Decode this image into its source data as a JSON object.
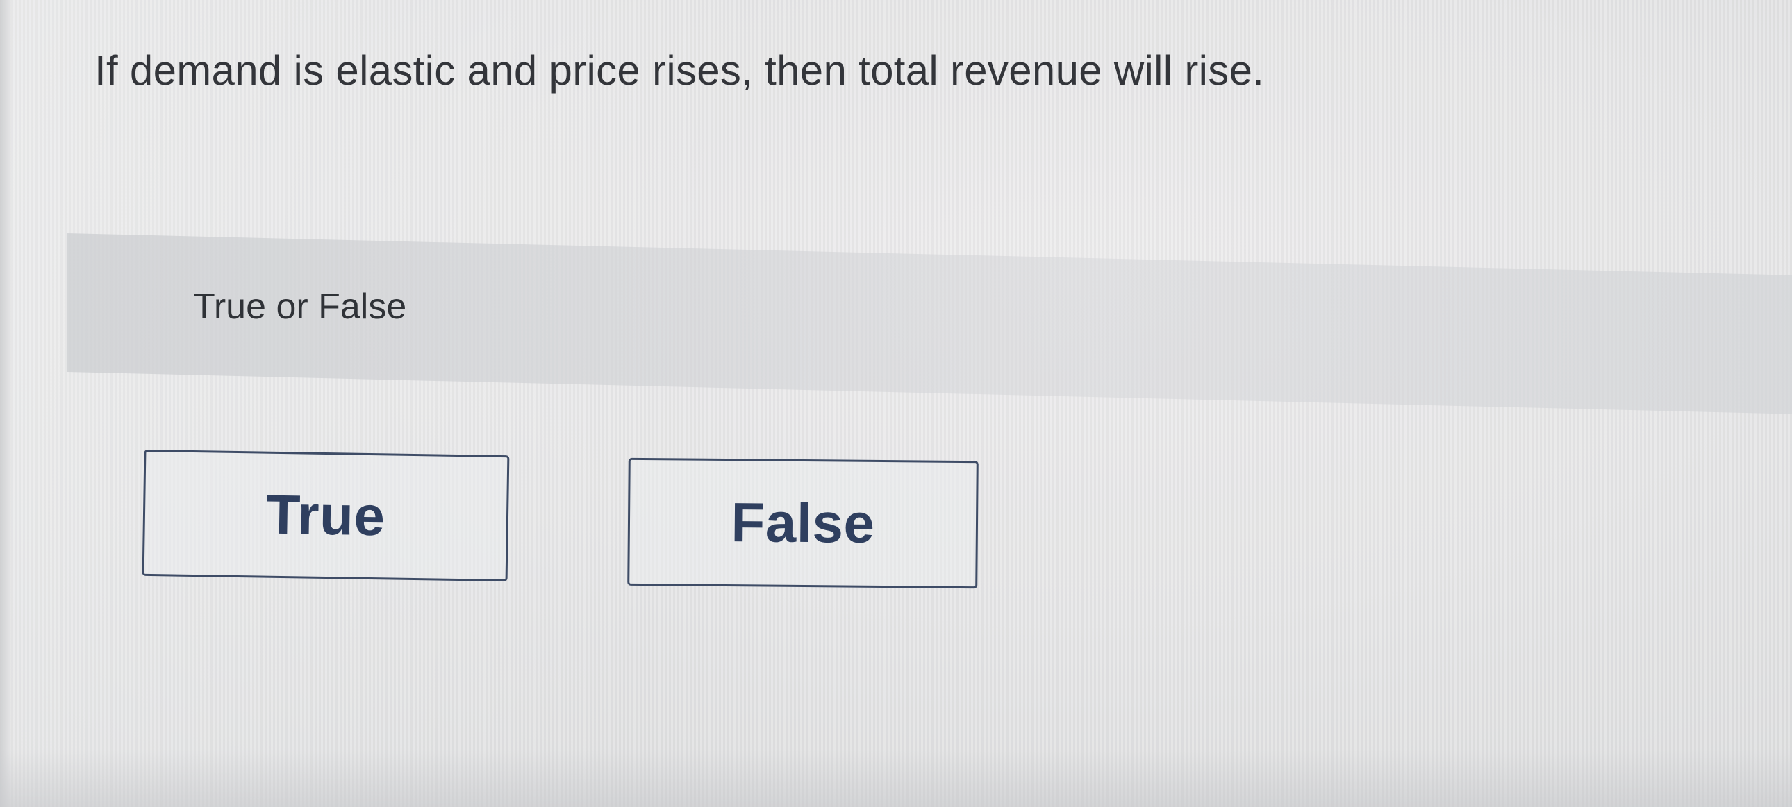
{
  "question": {
    "text": "If demand is elastic and price rises, then total revenue will rise."
  },
  "prompt": {
    "text": "True or False"
  },
  "choices": [
    {
      "label": "True"
    },
    {
      "label": "False"
    }
  ],
  "colors": {
    "button_border": "#3e4c66",
    "button_text": "#2f3f5f",
    "body_text": "#33353a"
  }
}
